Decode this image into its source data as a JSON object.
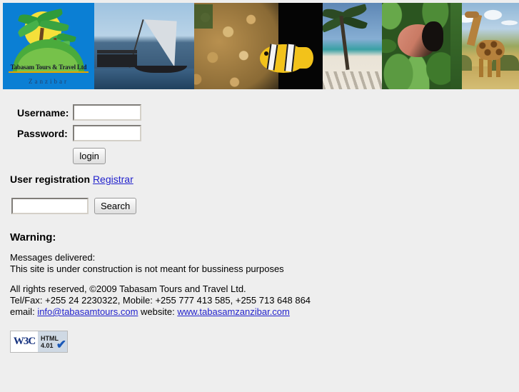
{
  "banner": {
    "logo": {
      "company_line": "Tabasam Tours & Travel Ltd",
      "location_line": "Zanzibar",
      "alt": "tabasam-tours-logo",
      "background_color": "#0b7fd4"
    },
    "photos": [
      {
        "name": "dhow-sailing-boat-photo",
        "alt": "Traditional dhow sailing boat"
      },
      {
        "name": "coral-reef-clownfish-photo",
        "alt": "Clownfish in coral anemone"
      },
      {
        "name": "beach-palm-tree-photo",
        "alt": "White sand beach with palm tree"
      },
      {
        "name": "red-colobus-monkey-photo",
        "alt": "Red colobus monkey in foliage"
      },
      {
        "name": "giraffe-savanna-photo",
        "alt": "Giraffe in savanna grassland"
      }
    ]
  },
  "login": {
    "username_label": "Username:",
    "username_value": "",
    "username_placeholder": "",
    "password_label": "Password:",
    "password_value": "",
    "password_placeholder": "",
    "submit_label": "login"
  },
  "registration": {
    "text": "User registration",
    "link_label": "Registrar"
  },
  "search": {
    "value": "",
    "placeholder": "",
    "button_label": "Search"
  },
  "warning": {
    "heading": "Warning:",
    "messages_label": "Messages delivered:",
    "message_text": "This site is under construction is not meant for bussiness purposes"
  },
  "footer": {
    "rights": "All rights reserved, ©2009 Tabasam Tours and Travel Ltd.",
    "phone_line": "Tel/Fax: +255 24 2230322, Mobile: +255 777 413 585, +255 713 648 864",
    "email_prefix": "email:",
    "email": "info@tabasamtours.com",
    "website_prefix": "website:",
    "website": "www.tabasamzanzibar.com"
  },
  "w3c_badge": {
    "logo_text": "W3C",
    "standard": "HTML",
    "version": "4.01",
    "check_glyph": "✔"
  },
  "colors": {
    "page_background": "#eeeeee",
    "link": "#2222cc",
    "logo_blue": "#0b7fd4",
    "logo_rule": "#e2a400"
  }
}
